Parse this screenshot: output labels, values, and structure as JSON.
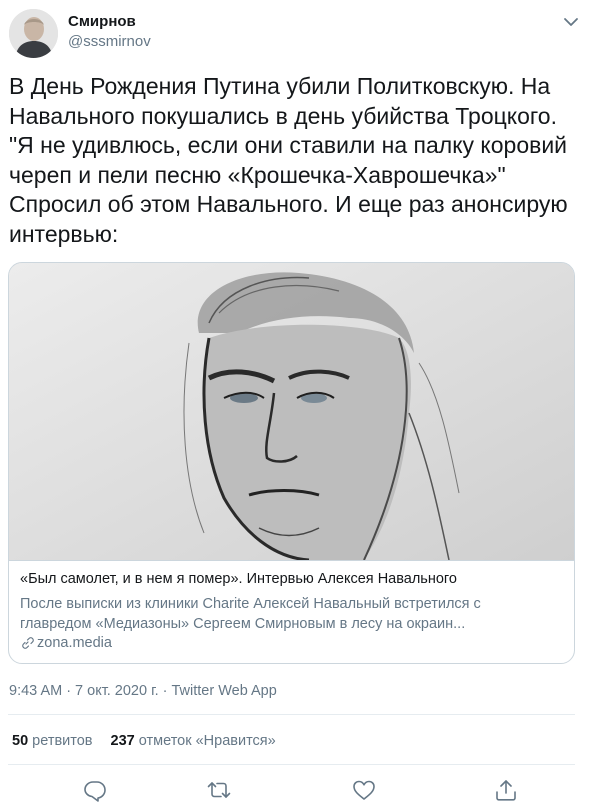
{
  "user": {
    "display_name": "Смирнов",
    "handle": "@sssmirnov",
    "avatar_icon": "user-avatar-photo"
  },
  "tweet": {
    "text": "В День Рождения Путина убили Политковскую. На\nНавального покушались в день убийства Троцкого.\n\"Я не удивлюсь, если они ставили на палку коровий\nчереп и пели песню «Крошечка-Хаврошечка»\"\nСпросил об этом Навального. И еще раз анонсирую\nинтервью:"
  },
  "card": {
    "image_icon": "portrait-sketch-image",
    "title": "«Был самолет, и в нем я помер». Интервью Алексея Навального",
    "description_line1": "После выписки из клиники Charite Алексей Навальный встретился с",
    "description_line2": "главредом «Медиазоны» Сергеем Смирновым в лесу на окраин...",
    "domain": "zona.media",
    "link_icon": "link-icon"
  },
  "meta": {
    "time": "9:43 AM",
    "separator": "·",
    "date": "7 окт. 2020 г.",
    "source": "Twitter Web App"
  },
  "stats": {
    "retweets_count": "50",
    "retweets_label": "ретвитов",
    "likes_count": "237",
    "likes_label": "отметок «Нравится»"
  },
  "colors": {
    "text": "#14171a",
    "secondary": "#657786",
    "border": "#ccd6dd",
    "divider": "#e6ecf0"
  },
  "actions": [
    "reply-icon",
    "retweet-icon",
    "like-icon",
    "share-icon"
  ]
}
